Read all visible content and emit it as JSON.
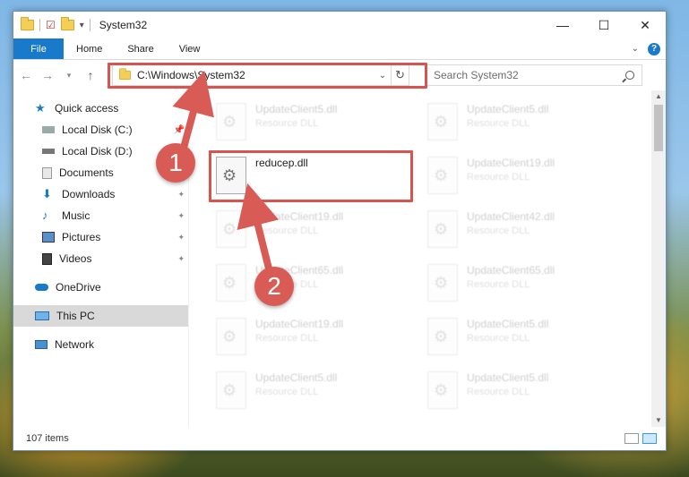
{
  "window": {
    "title": "System32",
    "controls": {
      "minimize": "—",
      "maximize": "☐",
      "close": "✕"
    }
  },
  "ribbon": {
    "tabs": [
      "File",
      "Home",
      "Share",
      "View"
    ],
    "help": "?"
  },
  "address": {
    "path": "C:\\Windows\\System32",
    "search_placeholder": "Search System32"
  },
  "sidebar": {
    "items": [
      {
        "label": "Quick access",
        "icon": "star-icon"
      },
      {
        "label": "Local Disk (C:)",
        "icon": "drive-icon"
      },
      {
        "label": "Local Disk (D:)",
        "icon": "drive-icon"
      },
      {
        "label": "Documents",
        "icon": "documents-icon"
      },
      {
        "label": "Downloads",
        "icon": "downloads-icon"
      },
      {
        "label": "Music",
        "icon": "music-icon"
      },
      {
        "label": "Pictures",
        "icon": "pictures-icon"
      },
      {
        "label": "Videos",
        "icon": "videos-icon"
      },
      {
        "label": "OneDrive",
        "icon": "cloud-icon"
      },
      {
        "label": "This PC",
        "icon": "computer-icon"
      },
      {
        "label": "Network",
        "icon": "network-icon"
      }
    ]
  },
  "files": [
    {
      "name": "UpdateClient5.dll",
      "type": "Resource DLL"
    },
    {
      "name": "UpdateClient5.dll",
      "type": "Resource DLL"
    },
    {
      "name": "reducep.dll",
      "type": ""
    },
    {
      "name": "UpdateClient19.dll",
      "type": "Resource DLL"
    },
    {
      "name": "UpdateClient19.dll",
      "type": "Resource DLL"
    },
    {
      "name": "UpdateClient42.dll",
      "type": "Resource DLL"
    },
    {
      "name": "UpdateClient65.dll",
      "type": "Resource DLL"
    },
    {
      "name": "UpdateClient65.dll",
      "type": "Resource DLL"
    },
    {
      "name": "UpdateClient19.dll",
      "type": "Resource DLL"
    },
    {
      "name": "UpdateClient5.dll",
      "type": "Resource DLL"
    },
    {
      "name": "UpdateClient5.dll",
      "type": "Resource DLL"
    },
    {
      "name": "UpdateClient5.dll",
      "type": "Resource DLL"
    }
  ],
  "status": {
    "item_count": "107 items"
  },
  "annotations": {
    "badge1": "1",
    "badge2": "2"
  },
  "colors": {
    "accent": "#1979ca",
    "highlight": "#d9534f"
  }
}
